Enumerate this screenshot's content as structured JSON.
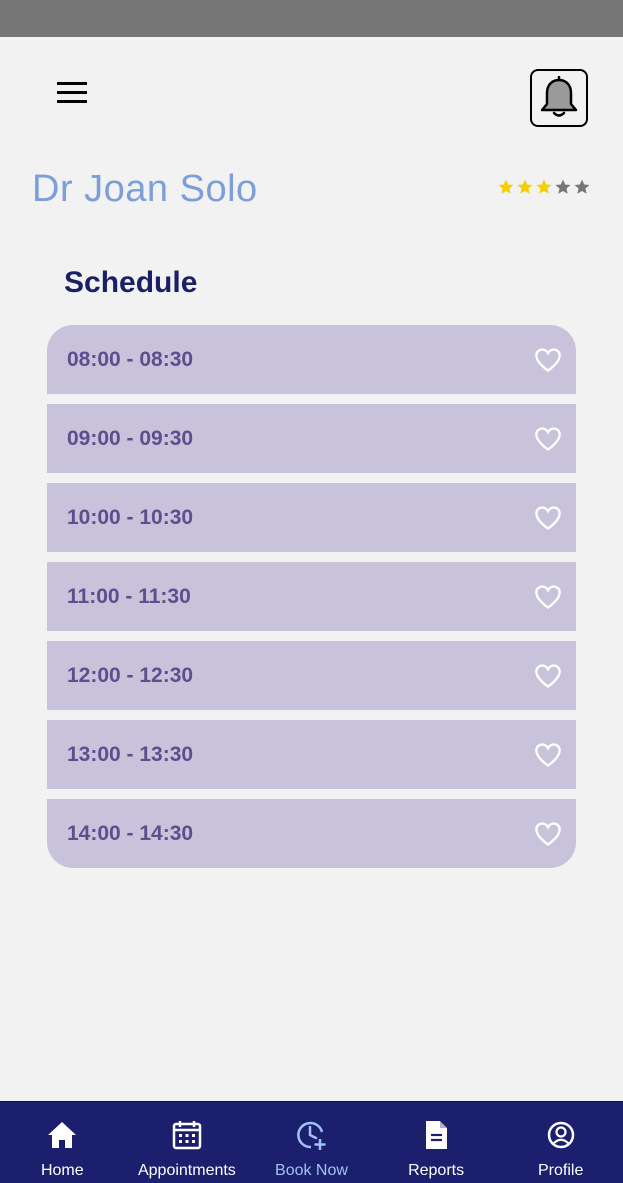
{
  "header": {
    "menu_icon": "hamburger-menu-icon",
    "bell_icon": "bell-icon"
  },
  "doctor": {
    "name": "Dr Joan Solo",
    "rating": 3,
    "rating_max": 5,
    "star_filled_color": "#f5cf00",
    "star_empty_color": "#777777"
  },
  "schedule": {
    "title": "Schedule",
    "slots": [
      {
        "time": "08:00 - 08:30",
        "icon": "heart-outline-icon"
      },
      {
        "time": "09:00 - 09:30",
        "icon": "heart-outline-icon"
      },
      {
        "time": "10:00 - 10:30",
        "icon": "heart-outline-icon"
      },
      {
        "time": "11:00 - 11:30",
        "icon": "heart-outline-icon"
      },
      {
        "time": "12:00 - 12:30",
        "icon": "heart-outline-icon"
      },
      {
        "time": "13:00 - 13:30",
        "icon": "heart-outline-icon"
      },
      {
        "time": "14:00 - 14:30",
        "icon": "heart-outline-icon"
      }
    ]
  },
  "nav": {
    "items": [
      {
        "label": "Home",
        "icon": "home-icon",
        "active": false
      },
      {
        "label": "Appointments",
        "icon": "calendar-icon",
        "active": false
      },
      {
        "label": "Book Now",
        "icon": "clock-plus-icon",
        "active": true
      },
      {
        "label": "Reports",
        "icon": "document-icon",
        "active": false
      },
      {
        "label": "Profile",
        "icon": "profile-icon",
        "active": false
      }
    ]
  },
  "colors": {
    "background": "#f2f2f2",
    "name": "#7b9fd6",
    "section_title": "#1b1f66",
    "slot_bg": "#c8c3da",
    "slot_text": "#5b4f8e",
    "nav_bg": "#1b1f6e",
    "nav_active": "#9fc3f0"
  }
}
